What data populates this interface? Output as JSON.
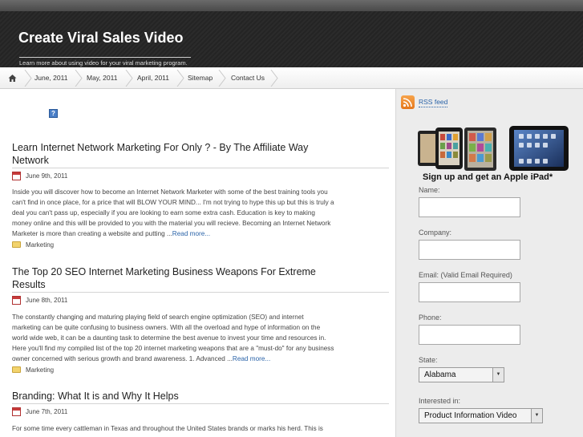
{
  "site": {
    "title": "Create Viral Sales Video",
    "description": "Learn more about using video for your viral marketing program."
  },
  "nav": {
    "items": [
      "June, 2011",
      "May, 2011",
      "April, 2011",
      "Sitemap",
      "Contact Us"
    ]
  },
  "sidebar": {
    "rss_label": "RSS feed",
    "banner_caption": "Sign up and get an Apple iPad*",
    "form": {
      "name_label": "Name:",
      "company_label": "Company:",
      "email_label": "Email: (Valid Email Required)",
      "phone_label": "Phone:",
      "state_label": "State:",
      "state_value": "Alabama",
      "interest_label": "Interested in:",
      "interest_value": "Product Information Video"
    }
  },
  "posts": [
    {
      "title_line1": "Learn Internet Network Marketing For Only ? - By The Affiliate Way",
      "title_line2": "Network",
      "date": "June 9th, 2011",
      "body_lines": [
        "Inside you will discover how to become an Internet Network Marketer with some of the best training tools you",
        "can't find in once place, for a price that will BLOW YOUR MIND... I'm not trying to hype this up but this is truly a",
        "deal you can't pass up, especially if you are looking to earn some extra cash.  Education is key to making",
        "money online and this will be provided to you with the material you will recieve.  Becoming an Internet Network",
        "Marketer is more than creating a website and putting ..."
      ],
      "read_more": "Read more...",
      "category": "Marketing"
    },
    {
      "title_line1": "The Top 20 SEO Internet Marketing Business Weapons For Extreme",
      "title_line2": "Results",
      "date": "June 8th, 2011",
      "body_lines": [
        "The constantly changing and maturing playing field of search engine optimization (SEO) and internet",
        "marketing can be quite confusing to business owners. With all the overload and hype of information on the",
        "world wide web, it can be a daunting task to determine the best avenue to invest your time and resources in.",
        "Here you'll find my compiled list of the top 20 internet marketing weapons that are a \"must-do\" for any business",
        "owner concerned with serious growth and brand awareness. 1. Advanced ..."
      ],
      "read_more": "Read more...",
      "category": "Marketing"
    },
    {
      "title_line1": "Branding: What It is and Why It Helps",
      "date": "June 7th, 2011",
      "body_lines": [
        "For some time every cattleman in Texas and throughout the United States brands or marks his herd. This is"
      ]
    }
  ],
  "colors": {
    "link": "#2a63a8",
    "header_bg": "#2b2b2b",
    "sidebar_bg": "#ececec"
  }
}
